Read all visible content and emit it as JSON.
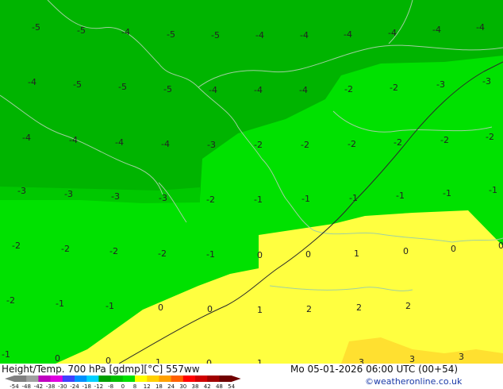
{
  "title": "Height/Temp. 700 hPa [gdmp][°C] 557ww",
  "datetime": "Mo 05-01-2026 06:00 UTC (00+54)",
  "credit": "©weatheronline.co.uk",
  "colors": {
    "dark_green": "#00b400",
    "mid_green": "#00c800",
    "green": "#00e100",
    "yellow": "#ffff40",
    "yellow_dark": "#ffe030",
    "coast": "#a0d0a0",
    "isoline": "#2a2a2a"
  },
  "temp_labels": [
    "-5",
    "-5",
    "-4",
    "-5",
    "-5",
    "-4",
    "-4",
    "-4",
    "-4",
    "-4",
    "-4",
    "-4",
    "-5",
    "-5",
    "-5",
    "-4",
    "-4",
    "-4",
    "-2",
    "-2",
    "-3",
    "-3",
    "-4",
    "-4",
    "-4",
    "-4",
    "-3",
    "-2",
    "-2",
    "-2",
    "-2",
    "-2",
    "-2",
    "-3",
    "-3",
    "-3",
    "-3",
    "-2",
    "-1",
    "-1",
    "-1",
    "-1",
    "-1",
    "-1",
    "-2",
    "-2",
    "-2",
    "-2",
    "-1",
    "0",
    "0",
    "1",
    "0",
    "0",
    "0",
    "-2",
    "-1",
    "-1",
    "0",
    "0",
    "1",
    "2",
    "2",
    "2",
    "-1",
    "0",
    "0",
    "1",
    "0",
    "1",
    "3",
    "3",
    "3"
  ],
  "scale": {
    "ticks": [
      "-54",
      "-48",
      "-42",
      "-38",
      "-30",
      "-24",
      "-18",
      "-12",
      "-8",
      "0",
      "8",
      "12",
      "18",
      "24",
      "30",
      "38",
      "42",
      "48",
      "54"
    ],
    "colors": [
      "#808080",
      "#a0a0a0",
      "#c000c0",
      "#e000e0",
      "#4040ff",
      "#0090ff",
      "#00d0ff",
      "#00a000",
      "#00c000",
      "#00e000",
      "#ffff00",
      "#ffd000",
      "#ffa000",
      "#ff6000",
      "#ff0000",
      "#d00000",
      "#a00000",
      "#700000"
    ]
  }
}
